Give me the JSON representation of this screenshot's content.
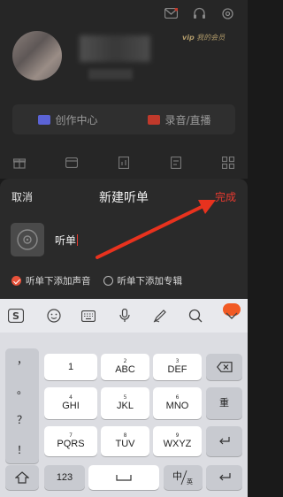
{
  "background": {
    "member_label": "我的会员",
    "vip_text": "vip",
    "creator_center": "创作中心",
    "record_live": "录音/直播"
  },
  "sheet": {
    "cancel": "取消",
    "title": "新建听单",
    "done": "完成",
    "name_value": "听单",
    "options": [
      {
        "label": "听单下添加声音",
        "selected": true
      },
      {
        "label": "听单下添加专辑",
        "selected": false
      }
    ]
  },
  "keyboard": {
    "rows": [
      [
        {
          "num": "",
          "letters": "1"
        },
        {
          "num": "2",
          "letters": "ABC"
        },
        {
          "num": "3",
          "letters": "DEF"
        }
      ],
      [
        {
          "num": "4",
          "letters": "GHI"
        },
        {
          "num": "5",
          "letters": "JKL"
        },
        {
          "num": "6",
          "letters": "MNO"
        }
      ],
      [
        {
          "num": "7",
          "letters": "PQRS"
        },
        {
          "num": "8",
          "letters": "TUV"
        },
        {
          "num": "9",
          "letters": "WXYZ"
        }
      ]
    ],
    "punct": [
      "，",
      "。",
      "？",
      "！"
    ],
    "reenter": "重",
    "num_key": "123",
    "lang_key_main": "中",
    "lang_key_sub": "英",
    "accent_color": "#e83a30"
  }
}
